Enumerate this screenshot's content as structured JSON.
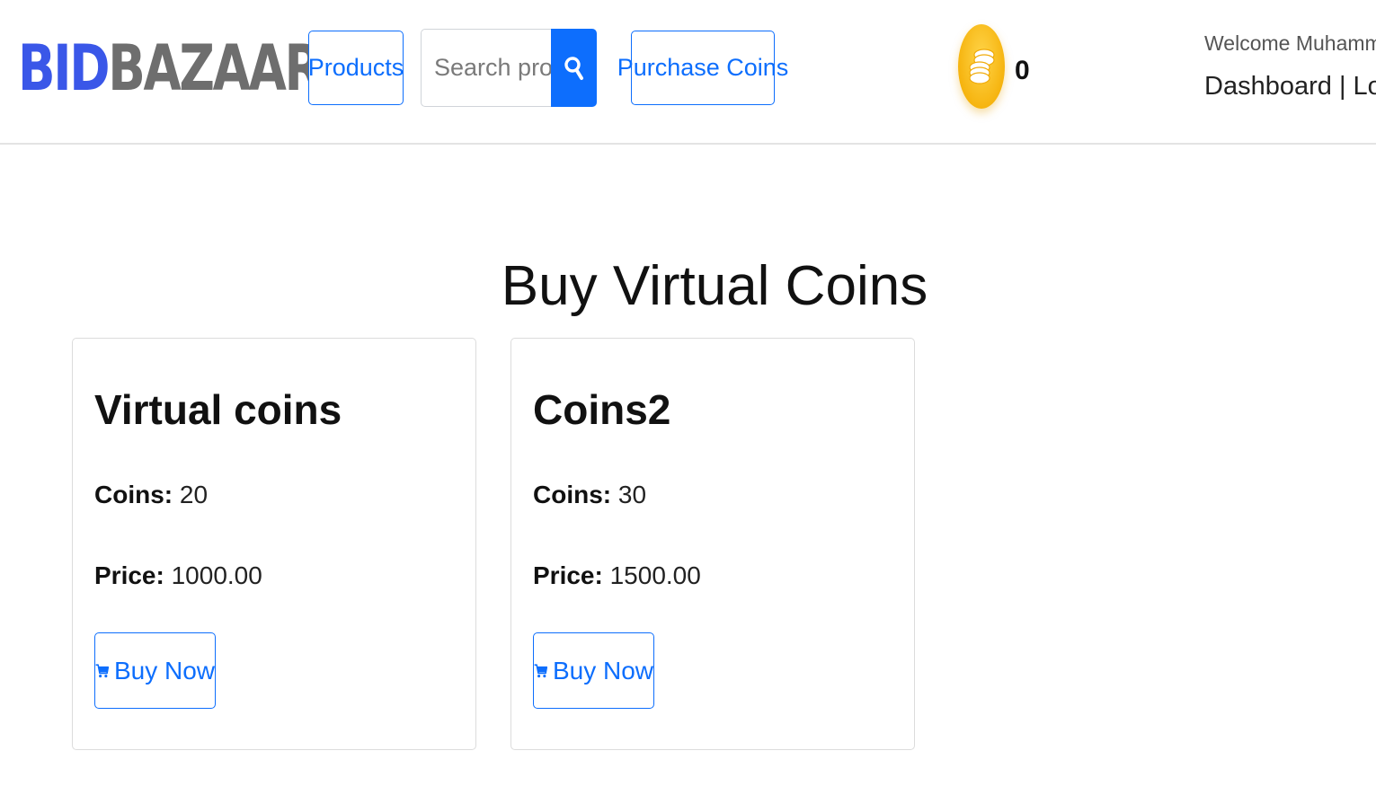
{
  "brand": {
    "part1": "BID",
    "part2": "BAZAAR",
    "color1": "#3a57e8",
    "color2": "#6e6e6e"
  },
  "nav": {
    "products_label": "Products",
    "search_placeholder": "Search produ",
    "search_icon": "search-icon",
    "purchase_label": "Purchase Coins"
  },
  "wallet": {
    "icon": "coins-icon",
    "balance": "0"
  },
  "user": {
    "welcome": "Welcome Muhammad",
    "dashboard_label": "Dashboard",
    "separator": "|",
    "logout_label": "Logout"
  },
  "page": {
    "title": "Buy Virtual Coins"
  },
  "packages": [
    {
      "name": "Virtual coins",
      "coins_label": "Coins:",
      "coins": "20",
      "price_label": "Price:",
      "price": "1000.00",
      "button": "Buy Now",
      "button_icon": "cart-icon"
    },
    {
      "name": "Coins2",
      "coins_label": "Coins:",
      "coins": "30",
      "price_label": "Price:",
      "price": "1500.00",
      "button": "Buy Now",
      "button_icon": "cart-icon"
    }
  ],
  "colors": {
    "accent": "#0d6efd",
    "coin": "#f6b40f"
  }
}
